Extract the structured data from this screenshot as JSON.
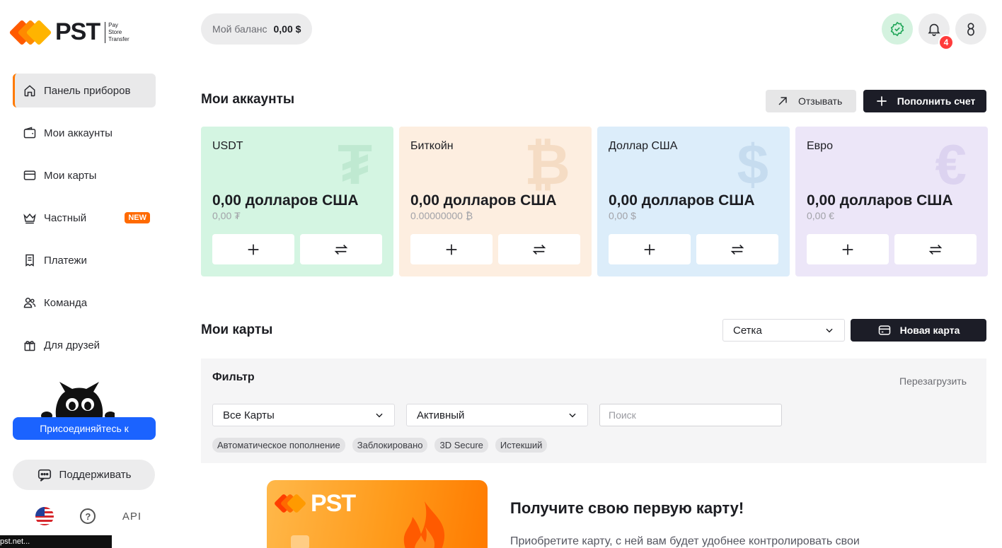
{
  "logo": {
    "text": "PST",
    "sub_lines": [
      "Pay",
      "Store",
      "Transfer"
    ]
  },
  "sidebar": {
    "items": [
      {
        "label": "Панель приборов",
        "icon": "home-icon",
        "active": true
      },
      {
        "label": "Мои аккаунты",
        "icon": "wallet-icon"
      },
      {
        "label": "Мои карты",
        "icon": "card-icon"
      },
      {
        "label": "Частный",
        "icon": "crown-icon",
        "badge": "NEW"
      },
      {
        "label": "Платежи",
        "icon": "receipt-icon"
      },
      {
        "label": "Команда",
        "icon": "team-icon"
      },
      {
        "label": "Для друзей",
        "icon": "gift-icon"
      }
    ],
    "join_label": "Присоединяйтесь к",
    "support_label": "Поддерживать",
    "api_label": "API",
    "status_url": "pst.net..."
  },
  "header": {
    "balance_label": "Мой баланс",
    "balance_value": "0,00 $",
    "notification_count": "4"
  },
  "accounts": {
    "title": "Мои аккаунты",
    "withdraw_label": "Отзывать",
    "topup_label": "Пополнить счет",
    "items": [
      {
        "name": "USDT",
        "amount": "0,00 долларов США",
        "sub": "0,00 ₮",
        "symbol": "₮",
        "bg": "#d4f5e2",
        "symbol_color": "#bfe9d1"
      },
      {
        "name": "Биткойн",
        "amount": "0,00 долларов США",
        "sub": "0.00000000 ₿",
        "symbol": "₿",
        "bg": "#fdeee0",
        "symbol_color": "#f5dcc4"
      },
      {
        "name": "Доллар США",
        "amount": "0,00 долларов США",
        "sub": "0,00 $",
        "symbol": "$",
        "bg": "#dcedfa",
        "symbol_color": "#c6dcef"
      },
      {
        "name": "Евро",
        "amount": "0,00 долларов США",
        "sub": "0,00 €",
        "symbol": "€",
        "bg": "#ece6f8",
        "symbol_color": "#dcd3f0"
      }
    ]
  },
  "cards": {
    "title": "Мои карты",
    "view_select": "Сетка",
    "new_card_label": "Новая карта",
    "filter": {
      "title": "Фильтр",
      "reload_label": "Перезагрузить",
      "type_select": "Все Карты",
      "status_select": "Активный",
      "search_placeholder": "Поиск",
      "tags": [
        "Автоматическое пополнение",
        "Заблокировано",
        "3D Secure",
        "Истекший"
      ]
    },
    "promo": {
      "logo_text": "PST",
      "title": "Получите свою первую карту!",
      "description": "Приобретите карту, с ней вам будет удобнее контролировать свои"
    }
  },
  "colors": {
    "accent": "#ff7a00",
    "primary_blue": "#1b63ff",
    "dark_button": "#1c1d27",
    "notification": "#ff3b3b"
  }
}
